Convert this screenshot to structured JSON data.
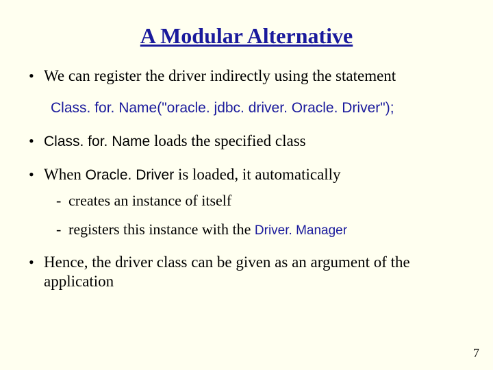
{
  "title": "A Modular Alternative",
  "bullets": {
    "b1": "We can register the driver indirectly using the statement",
    "code": "Class. for. Name(\"oracle. jdbc. driver. Oracle. Driver\");",
    "b2_code": "Class. for. Name",
    "b2_rest": " loads the specified class",
    "b3_pre": "When ",
    "b3_code": "Oracle. Driver",
    "b3_post": " is loaded, it automatically",
    "sub1": "creates an instance of itself",
    "sub2_pre": "registers this instance with the ",
    "sub2_code": "Driver. Manager",
    "b4": "Hence, the driver class can be given as an argument of the application"
  },
  "page_number": "7"
}
